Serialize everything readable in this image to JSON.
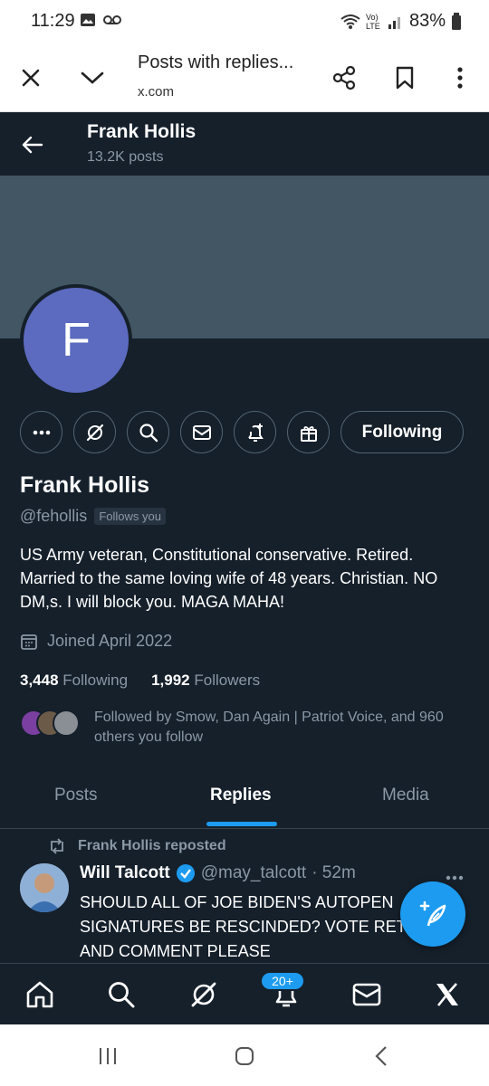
{
  "status_bar": {
    "time": "11:29",
    "battery": "83%",
    "network_label": "Vo) LTE"
  },
  "browser": {
    "title": "Posts with replies...",
    "url": "x.com",
    "icons": [
      "close-icon",
      "chevron-down-icon",
      "share-icon",
      "bookmark-icon",
      "more-vertical-icon"
    ]
  },
  "profile_nav": {
    "name": "Frank Hollis",
    "posts_count": "13.2K posts"
  },
  "profile": {
    "avatar_letter": "F",
    "name": "Frank Hollis",
    "handle": "@fehollis",
    "follows_you": "Follows you",
    "bio": "US Army veteran, Constitutional conservative. Retired. Married to the same loving wife of 48 years. Christian. NO DM,s. I will block you. MAGA MAHA!",
    "joined": "Joined April 2022",
    "following_count": "3,448",
    "following_label": "Following",
    "followers_count": "1,992",
    "followers_label": "Followers",
    "followed_by": "Followed by Smow, Dan Again | Patriot Voice, and 960 others you follow",
    "following_button": "Following"
  },
  "tabs": [
    "Posts",
    "Replies",
    "Media"
  ],
  "active_tab": "Replies",
  "tweet": {
    "repost_label": "Frank Hollis reposted",
    "author": "Will Talcott",
    "handle": "@may_talcott",
    "time": "· 52m",
    "text": "SHOULD ALL OF JOE BIDEN'S AUTOPEN SIGNATURES BE RESCINDED? VOTE RETWEET AND COMMENT PLEASE"
  },
  "bottom_nav": {
    "notif_badge": "20+"
  },
  "colors": {
    "background": "#15202b",
    "accent": "#1d9bf0",
    "banner": "#425664",
    "avatar": "#5c6bc0"
  }
}
